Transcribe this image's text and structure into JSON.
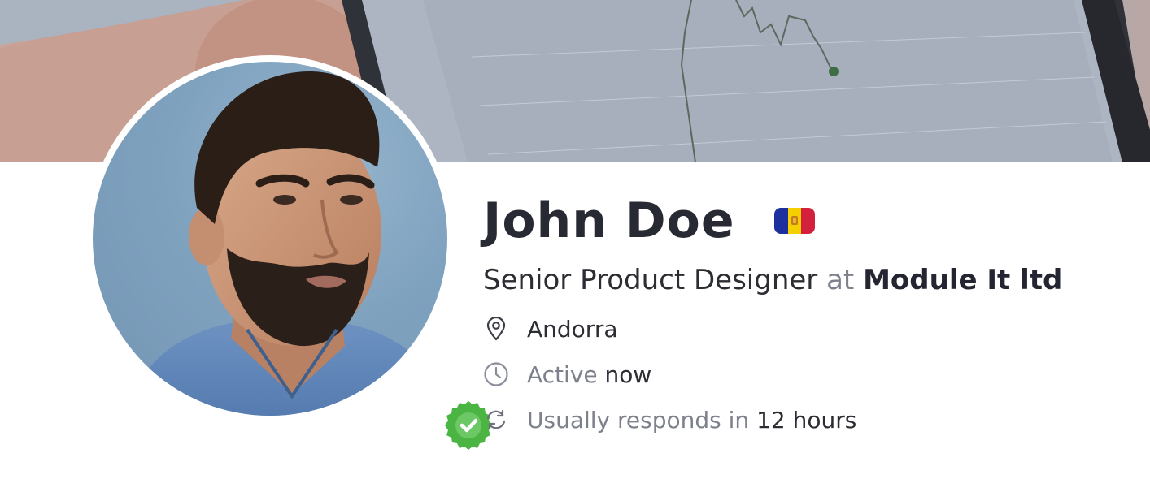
{
  "profile": {
    "name": "John Doe",
    "country_flag_icon": "andorra-flag-icon",
    "title": "Senior Product Designer",
    "at_word": "at",
    "company": "Module It ltd",
    "verified_icon": "verified-badge-icon"
  },
  "details": {
    "location": {
      "icon": "map-pin-icon",
      "value": "Andorra"
    },
    "activity": {
      "icon": "clock-icon",
      "label": "Active",
      "value": "now"
    },
    "response": {
      "icon": "refresh-icon",
      "label": "Usually responds in",
      "value": "12 hours"
    }
  },
  "colors": {
    "badge_green": "#4bb543",
    "flag_blue": "#1e2f9e",
    "flag_yellow": "#f5d000",
    "flag_red": "#d3203c"
  }
}
